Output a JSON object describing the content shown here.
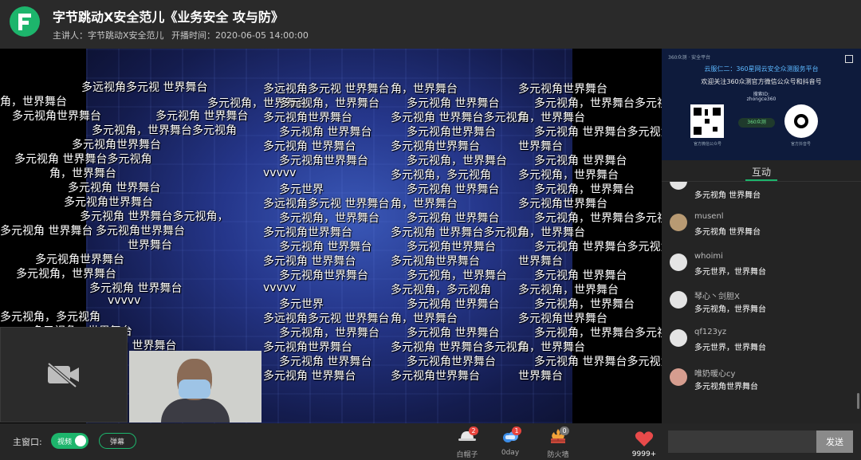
{
  "header": {
    "title": "字节跳动X安全范儿《业务安全 攻与防》",
    "host_label": "主讲人：字节跳动X安全范儿",
    "time_label": "开播时间：2020-06-05 14:00:00"
  },
  "danmaku": [
    "多远视角多元视 世界舞台",
    "角，世界舞台",
    "多元视角世界舞台",
    "多元视角，世界舞台",
    "多元视角 世界舞台",
    "多元视角，世界舞台多元视角",
    "多元视角世界舞台",
    "多元视角 世界舞台多元视角",
    "角，世界舞台",
    "多元视角 世界舞台",
    "多元视角世界舞台",
    "多元视角 世界舞台多元视角，",
    "多元视角 世界舞台",
    "多元视角世界舞台",
    "世界舞台",
    "多元视角世界舞台",
    "多元视角，世界舞台",
    "多元视角 世界舞台",
    "vvvvv",
    "多元视角，多元视角",
    "多元视角，世界舞台",
    "多元世界",
    "多元视角 世界舞台",
    "多元视角，世界舞台"
  ],
  "slide": {
    "topline": "360众测 · 安全平台",
    "title": "云服仁二：360星网云安全众测服务平台",
    "subtitle": "欢迎关注360众测官方微信公众号和抖音号",
    "search_id_label": "搜索ID:",
    "search_id": "zhongce360",
    "brand": "360众测",
    "left_caption": "官方微信公众号",
    "right_caption": "官方抖音号"
  },
  "tabs": {
    "interact": "互动"
  },
  "chat": [
    {
      "user": "",
      "text": "多元视角 世界舞台",
      "avatar": "white"
    },
    {
      "user": "musenl",
      "text": "多元视角 世界舞台",
      "avatar": "brown"
    },
    {
      "user": "whoimi",
      "text": "多元世界，世界舞台",
      "avatar": "white"
    },
    {
      "user": "琴心丶剑胆X",
      "text": "多元视角，世界舞台",
      "avatar": "white"
    },
    {
      "user": "qf123yz",
      "text": "多元世界，世界舞台",
      "avatar": "white"
    },
    {
      "user": "唯奶暖心cy",
      "text": "多元视角世界舞台",
      "avatar": "pink"
    }
  ],
  "bottom": {
    "main_window_label": "主窗口:",
    "video_toggle": "视频",
    "danmaku_btn": "弹幕",
    "gifts": [
      {
        "label": "白帽子",
        "count": "2",
        "badge_color": "#e7453e"
      },
      {
        "label": "0day",
        "count": "1",
        "badge_color": "#e7453e"
      },
      {
        "label": "防火墙",
        "count": "0",
        "badge_color": "#777777"
      }
    ],
    "likes": "9999+",
    "send": "发送",
    "input_placeholder": ""
  },
  "colors": {
    "accent": "#1db56c",
    "badge": "#e7453e",
    "like": "#e84a4a"
  }
}
